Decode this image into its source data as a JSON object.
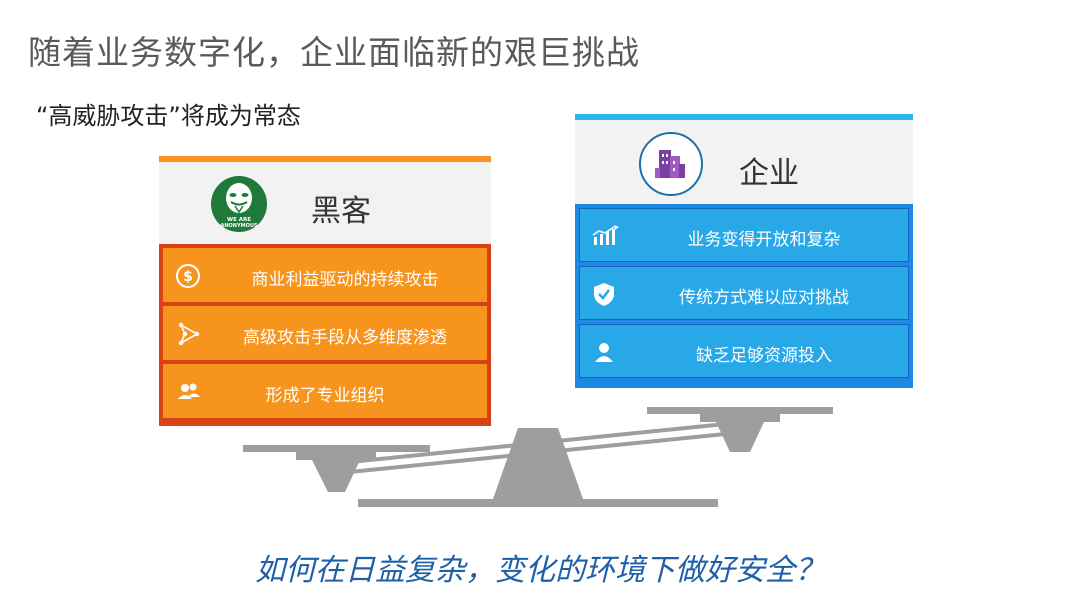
{
  "title": "随着业务数字化，企业面临新的艰巨挑战",
  "subtitle": "“高威胁攻击”将成为常态",
  "hacker": {
    "name": "黑客",
    "logo_text": "WE ARE ANONYMOUS",
    "items": [
      {
        "label": "商业利益驱动的持续攻击",
        "icon": "dollar-coin-icon"
      },
      {
        "label": "高级攻击手段从多维度渗透",
        "icon": "network-nodes-icon"
      },
      {
        "label": "形成了专业组织",
        "icon": "group-icon"
      }
    ]
  },
  "enterprise": {
    "name": "企业",
    "logo": "buildings-icon",
    "items": [
      {
        "label": "业务变得开放和复杂",
        "icon": "growth-chart-icon"
      },
      {
        "label": "传统方式难以应对挑战",
        "icon": "shield-check-icon"
      },
      {
        "label": "缺乏足够资源投入",
        "icon": "person-icon"
      }
    ]
  },
  "question": "如何在日益复杂，变化的环境下做好安全？",
  "colors": {
    "hacker_accent": "#f7941d",
    "hacker_border": "#d84315",
    "enterprise_accent": "#29b6f6",
    "enterprise_row": "#29a8e8",
    "enterprise_border": "#1e88e5",
    "scale": "#9e9e9e",
    "question": "#1f5fa8"
  }
}
